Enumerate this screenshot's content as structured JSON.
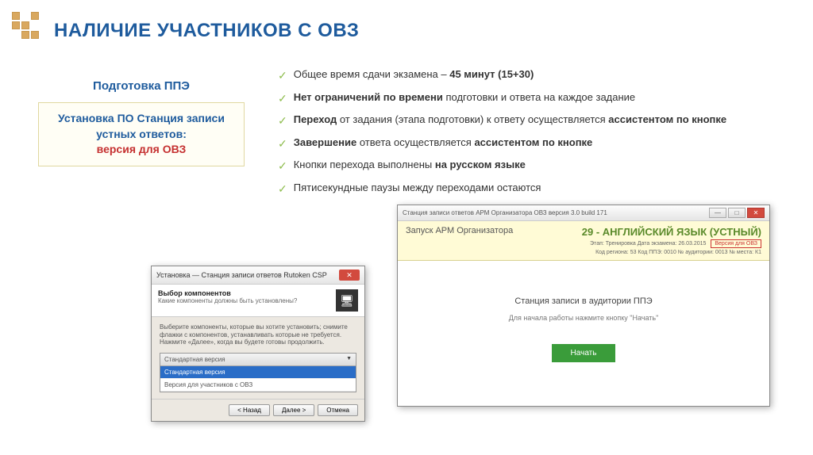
{
  "title": "НАЛИЧИЕ УЧАСТНИКОВ С ОВЗ",
  "left_panel": {
    "prep_title": "Подготовка ППЭ",
    "install_line1": "Установка ПО Станция записи устных ответов:",
    "install_line2": "версия для ОВЗ"
  },
  "bullets": [
    {
      "pre": "Общее время сдачи экзамена – ",
      "bold": "45 минут (15+30)",
      "post": ""
    },
    {
      "pre": "",
      "bold": "Нет ограничений по времени",
      "post": " подготовки и ответа на каждое задание"
    },
    {
      "pre": "",
      "bold": "Переход",
      "post": " от задания (этапа подготовки) к ответу осуществляется ",
      "bold2": "ассистентом по кнопке"
    },
    {
      "pre": "",
      "bold": "Завершение",
      "post": " ответа осуществляется ",
      "bold2": "ассистентом по кнопке"
    },
    {
      "pre": "Кнопки перехода выполнены ",
      "bold": "на русском языке",
      "post": ""
    },
    {
      "pre": "Пятисекундные паузы между переходами остаются",
      "bold": "",
      "post": ""
    }
  ],
  "installer": {
    "titlebar": "Установка — Станция записи ответов Rutoken CSP",
    "header_title": "Выбор компонентов",
    "header_sub": "Какие компоненты должны быть установлены?",
    "body_text": "Выберите компоненты, которые вы хотите установить; снимите флажки с компонентов, устанавливать которые не требуется. Нажмите «Далее», когда вы будете готовы продолжить.",
    "select_header": "Стандартная версия",
    "select_item_highlighted": "Стандартная версия",
    "select_item_other": "Версия для участников с ОВЗ",
    "btn_back": "< Назад",
    "btn_next": "Далее >",
    "btn_cancel": "Отмена"
  },
  "app": {
    "titlebar": "Станция записи ответов АРМ Организатора ОВЗ версия 3.0 build 171",
    "launch_label": "Запуск АРМ Организатора",
    "subject": "29 - АНГЛИЙСКИЙ ЯЗЫК (УСТНЫЙ)",
    "meta_line1": "Этап: Тренировка    Дата экзамена: 26.03.2015",
    "meta_line2": "Код региона: 53    Код ППЭ: 0010    № аудитории: 0013    № места: К1",
    "version_badge": "Версия для ОВЗ",
    "body_title": "Станция записи в аудитории ППЭ",
    "body_sub": "Для начала работы нажмите кнопку \"Начать\"",
    "start_btn": "Начать"
  }
}
